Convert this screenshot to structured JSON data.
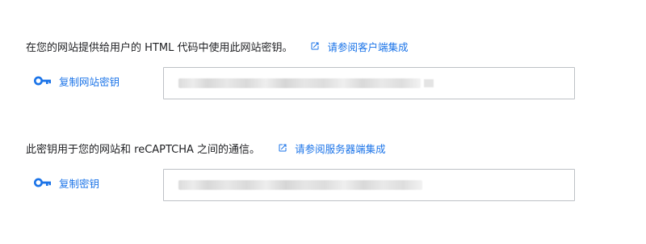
{
  "site_key_section": {
    "description": "在您的网站提供给用户的 HTML 代码中使用此网站密钥。",
    "link_label": "请参阅客户端集成",
    "link_icon": "open-in-new-icon",
    "copy_label": "复制网站密钥",
    "copy_icon": "key-icon",
    "key_value_visible": false
  },
  "secret_key_section": {
    "description": "此密钥用于您的网站和 reCAPTCHA 之间的通信。",
    "link_label": "请参阅服务器端集成",
    "link_icon": "open-in-new-icon",
    "copy_label": "复制密钥",
    "copy_icon": "key-icon",
    "key_value_visible": false
  },
  "colors": {
    "link": "#1a73e8",
    "text": "#202124",
    "border": "#bdc1c6"
  }
}
